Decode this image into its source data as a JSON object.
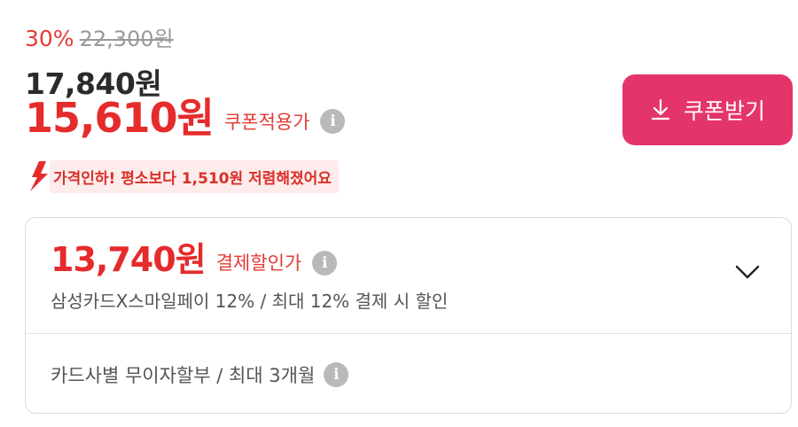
{
  "price": {
    "discount_percent": "30%",
    "original_price": "22,300원",
    "sale_price": "17,840원",
    "coupon_price": "15,610원",
    "coupon_label": "쿠폰적용가",
    "drop_message": "가격인하! 평소보다 1,510원 저렴해졌어요"
  },
  "coupon_button": {
    "label": "쿠폰받기",
    "icon": "download-icon"
  },
  "payment": {
    "price": "13,740원",
    "label": "결제할인가",
    "description": "삼성카드X스마일페이 12% / 최대 12% 결제 시 할인",
    "installment": "카드사별 무이자할부 / 최대 3개월"
  },
  "colors": {
    "accent_red": "#e52b2b",
    "button_pink": "#e4356a",
    "info_gray": "#b9b9b9"
  }
}
